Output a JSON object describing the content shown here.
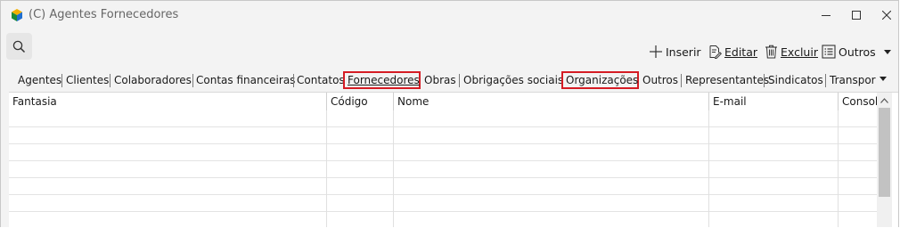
{
  "window": {
    "title": "(C) Agentes Fornecedores"
  },
  "toolbar": {
    "inserir": "Inserir",
    "editar": "Editar",
    "excluir": "Excluir",
    "outros": "Outros"
  },
  "tabs": [
    {
      "label": "Agentes"
    },
    {
      "label": "Clientes"
    },
    {
      "label": "Colaboradores"
    },
    {
      "label": "Contas financeiras"
    },
    {
      "label": "Contatos"
    },
    {
      "label": "Fornecedores",
      "highlighted": true,
      "active": true
    },
    {
      "label": "Obras"
    },
    {
      "label": "Obrigações sociais"
    },
    {
      "label": "Organizações",
      "highlighted": true
    },
    {
      "label": "Outros"
    },
    {
      "label": "Representantes"
    },
    {
      "label": "Sindicatos"
    },
    {
      "label": "Transpor"
    }
  ],
  "grid": {
    "columns": [
      "Fantasia",
      "Código",
      "Nome",
      "E-mail",
      "Consol"
    ]
  },
  "colors": {
    "highlight": "#d51c24",
    "background": "#f3f3f3"
  },
  "icons": {
    "app": "colorful-cube-icon",
    "search": "search-icon",
    "inserir": "plus-icon",
    "editar": "edit-document-icon",
    "excluir": "trash-icon",
    "outros": "list-icon"
  }
}
